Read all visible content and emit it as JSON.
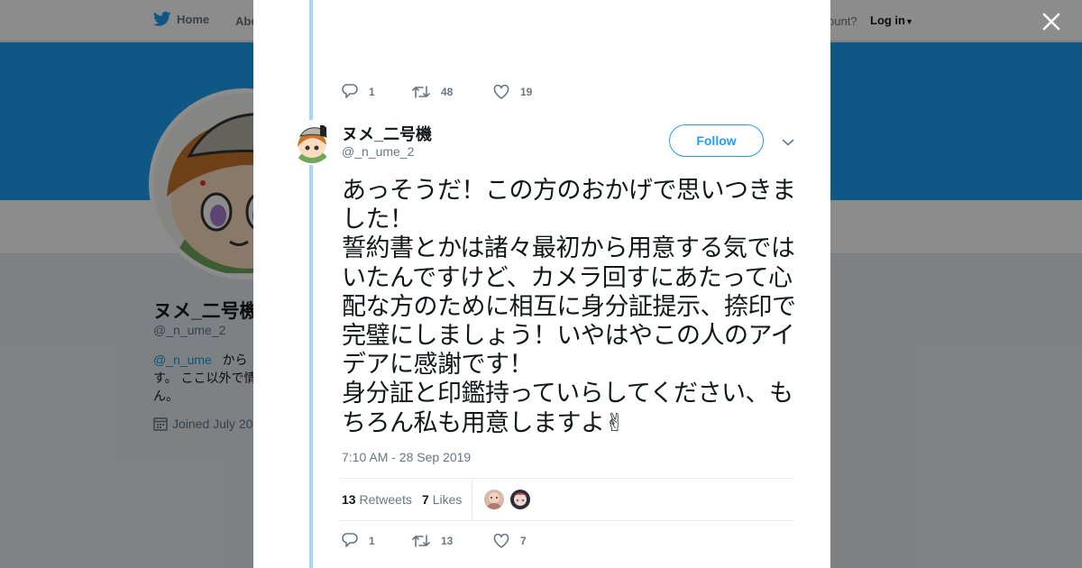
{
  "nav": {
    "home": "Home",
    "about": "Abo",
    "account": "ccount?",
    "login": "Log in"
  },
  "profile": {
    "name": "ヌメ_二号機",
    "handle": "@_n_ume_2",
    "bio_link": "@_n_ume",
    "bio_rest_1": "から",
    "bio_line2": "す。 ここ以外で情",
    "bio_line3": "ん。",
    "joined": "Joined July 20"
  },
  "prev_tweet": {
    "replies": "1",
    "retweets": "48",
    "likes": "19"
  },
  "tweet": {
    "name": "ヌメ_二号機",
    "handle": "@_n_ume_2",
    "follow_label": "Follow",
    "text": "あっそうだ！この方のおかげで思いつきました！\n誓約書とかは諸々最初から用意する気ではいたんですけど、カメラ回すにあたって心配な方のために相互に身分証提示、捺印で完璧にしましょう！いやはやこの人のアイデアに感謝です！\n身分証と印鑑持っていらしてください、もちろん私も用意しますよ✌",
    "time": "7:10 AM - 28 Sep 2019",
    "retweet_count": "13",
    "retweet_label": "Retweets",
    "like_count": "7",
    "like_label": "Likes",
    "replies": "1",
    "retweets": "13",
    "likes": "7"
  },
  "colors": {
    "accent": "#1da1f2",
    "thread": "#a6d5f7",
    "banner": "#1da1f2"
  }
}
